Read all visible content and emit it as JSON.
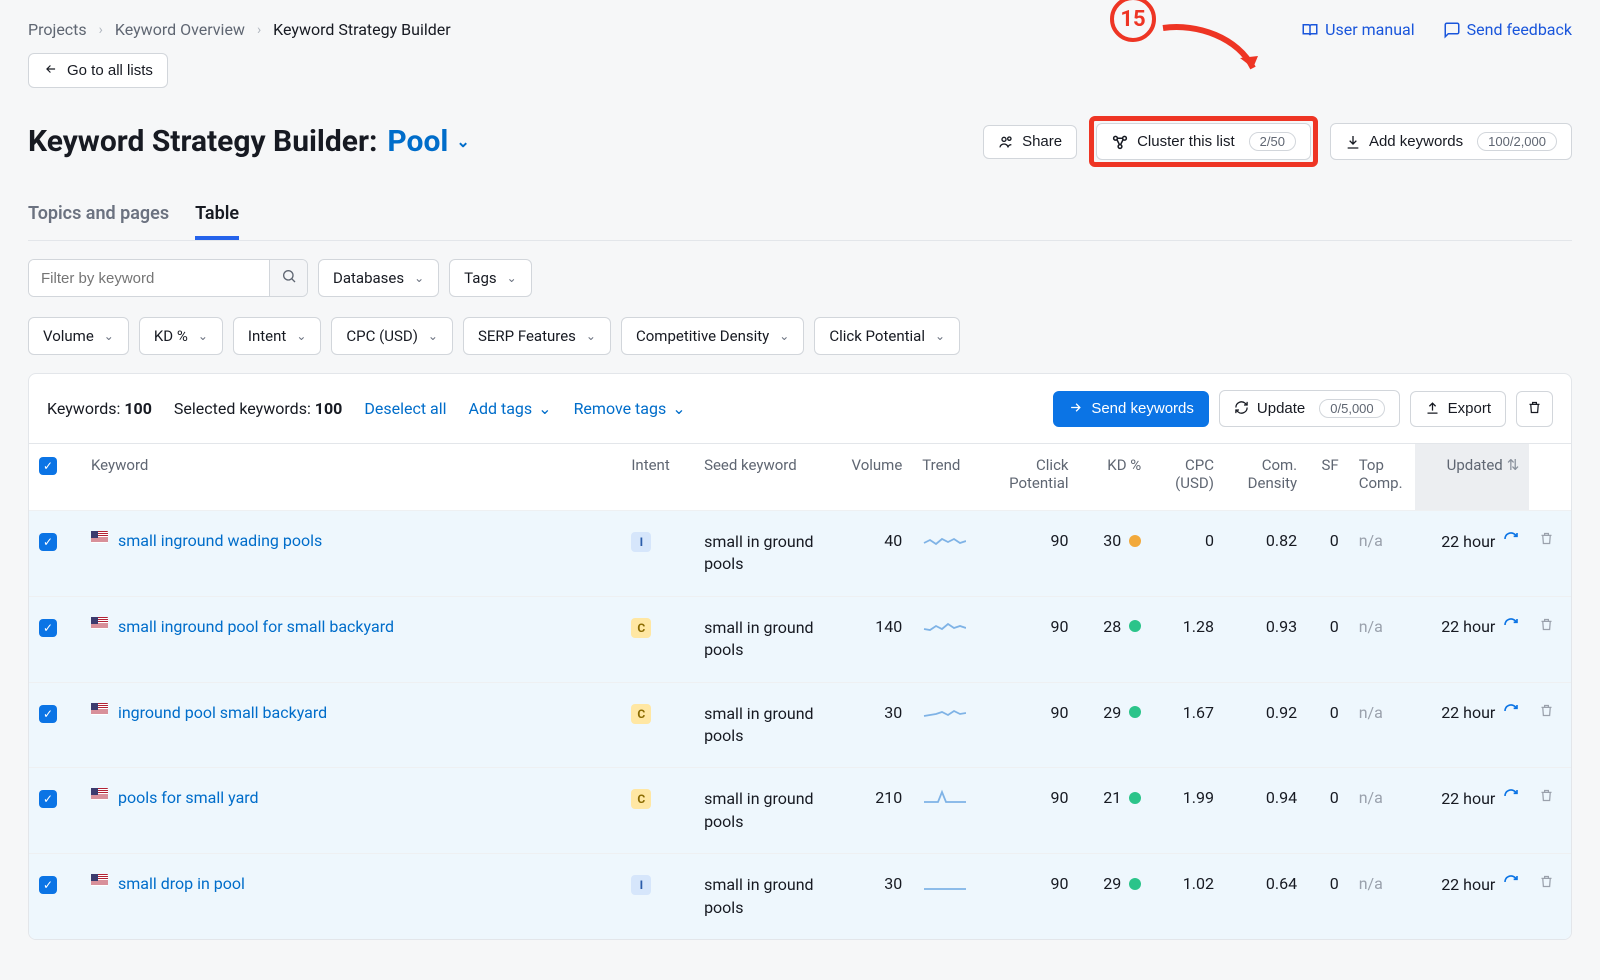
{
  "breadcrumbs": {
    "items": [
      "Projects",
      "Keyword Overview"
    ],
    "current": "Keyword Strategy Builder"
  },
  "top_links": {
    "manual": "User manual",
    "feedback": "Send feedback"
  },
  "go_back": "Go to all lists",
  "title": {
    "prefix": "Keyword Strategy Builder:",
    "list_name": "Pool"
  },
  "title_actions": {
    "share": "Share",
    "cluster": {
      "label": "Cluster this list",
      "badge": "2/50"
    },
    "add_keywords": {
      "label": "Add keywords",
      "badge": "100/2,000"
    }
  },
  "annotation": {
    "number": "15"
  },
  "tabs": {
    "topics": "Topics and pages",
    "table": "Table"
  },
  "filters": {
    "search_placeholder": "Filter by keyword",
    "databases": "Databases",
    "tags": "Tags",
    "volume": "Volume",
    "kd": "KD %",
    "intent": "Intent",
    "cpc": "CPC (USD)",
    "serp": "SERP Features",
    "density": "Competitive Density",
    "click": "Click Potential"
  },
  "action_bar": {
    "keywords_label": "Keywords:",
    "keywords_count": "100",
    "selected_label": "Selected keywords:",
    "selected_count": "100",
    "deselect": "Deselect all",
    "add_tags": "Add tags",
    "remove_tags": "Remove tags",
    "send": "Send keywords",
    "update": {
      "label": "Update",
      "badge": "0/5,000"
    },
    "export": "Export"
  },
  "columns": {
    "keyword": "Keyword",
    "intent": "Intent",
    "seed": "Seed keyword",
    "volume": "Volume",
    "trend": "Trend",
    "click": "Click Potential",
    "kd": "KD %",
    "cpc": "CPC (USD)",
    "com": "Com. Density",
    "sf": "SF",
    "top": "Top Comp.",
    "updated": "Updated"
  },
  "rows": [
    {
      "keyword": "small inground wading pools",
      "intent": "I",
      "seed": "small in ground pools",
      "volume": "40",
      "click": "90",
      "kd": "30",
      "kd_color": "orange",
      "cpc": "0",
      "com": "0.82",
      "sf": "0",
      "top": "n/a",
      "updated": "22 hour"
    },
    {
      "keyword": "small inground pool for small backyard",
      "intent": "C",
      "seed": "small in ground pools",
      "volume": "140",
      "click": "90",
      "kd": "28",
      "kd_color": "green",
      "cpc": "1.28",
      "com": "0.93",
      "sf": "0",
      "top": "n/a",
      "updated": "22 hour"
    },
    {
      "keyword": "inground pool small backyard",
      "intent": "C",
      "seed": "small in ground pools",
      "volume": "30",
      "click": "90",
      "kd": "29",
      "kd_color": "green",
      "cpc": "1.67",
      "com": "0.92",
      "sf": "0",
      "top": "n/a",
      "updated": "22 hour"
    },
    {
      "keyword": "pools for small yard",
      "intent": "C",
      "seed": "small in ground pools",
      "volume": "210",
      "click": "90",
      "kd": "21",
      "kd_color": "green",
      "cpc": "1.99",
      "com": "0.94",
      "sf": "0",
      "top": "n/a",
      "updated": "22 hour"
    },
    {
      "keyword": "small drop in pool",
      "intent": "I",
      "seed": "small in ground pools",
      "volume": "30",
      "click": "90",
      "kd": "29",
      "kd_color": "green",
      "cpc": "1.02",
      "com": "0.64",
      "sf": "0",
      "top": "n/a",
      "updated": "22 hour"
    }
  ]
}
